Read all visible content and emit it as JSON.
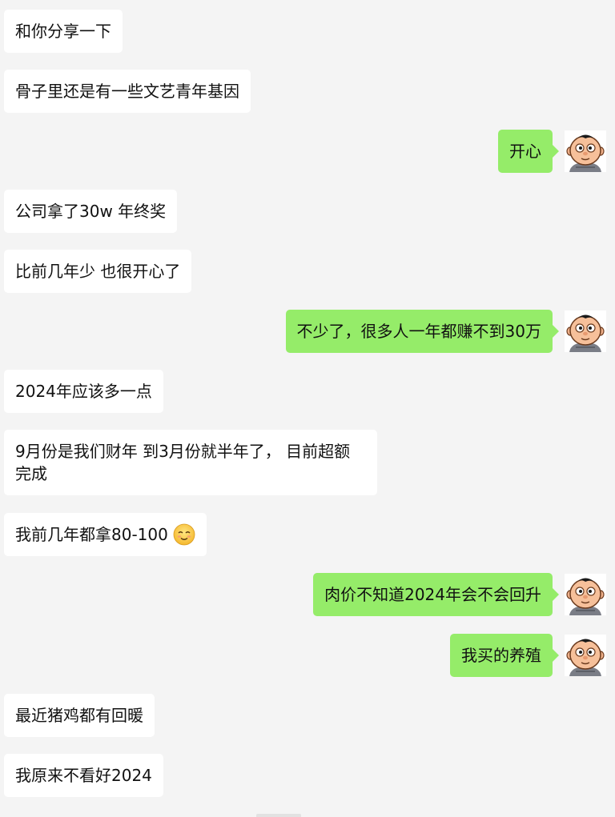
{
  "messages": [
    {
      "side": "left",
      "text": "和你分享一下"
    },
    {
      "side": "left",
      "text": "骨子里还是有一些文艺青年基因"
    },
    {
      "side": "right",
      "text": "开心"
    },
    {
      "side": "left",
      "text": "公司拿了30w 年终奖"
    },
    {
      "side": "left",
      "text": "比前几年少 也很开心了"
    },
    {
      "side": "right",
      "text": "不少了，很多人一年都赚不到30万"
    },
    {
      "side": "left",
      "text": "2024年应该多一点"
    },
    {
      "side": "left",
      "text": "9月份是我们财年 到3月份就半年了，  目前超额完成"
    },
    {
      "side": "left",
      "text": "我前几年都拿80-100",
      "emoji": "smiling-face-icon"
    },
    {
      "side": "right",
      "text": "肉价不知道2024年会不会回升"
    },
    {
      "side": "right",
      "text": "我买的养殖"
    },
    {
      "side": "left",
      "text": "最近猪鸡都有回暖"
    },
    {
      "side": "left",
      "text": "我原来不看好2024"
    }
  ],
  "colors": {
    "background": "#f4f4f4",
    "incoming_bubble": "#ffffff",
    "outgoing_bubble": "#95ec69"
  }
}
